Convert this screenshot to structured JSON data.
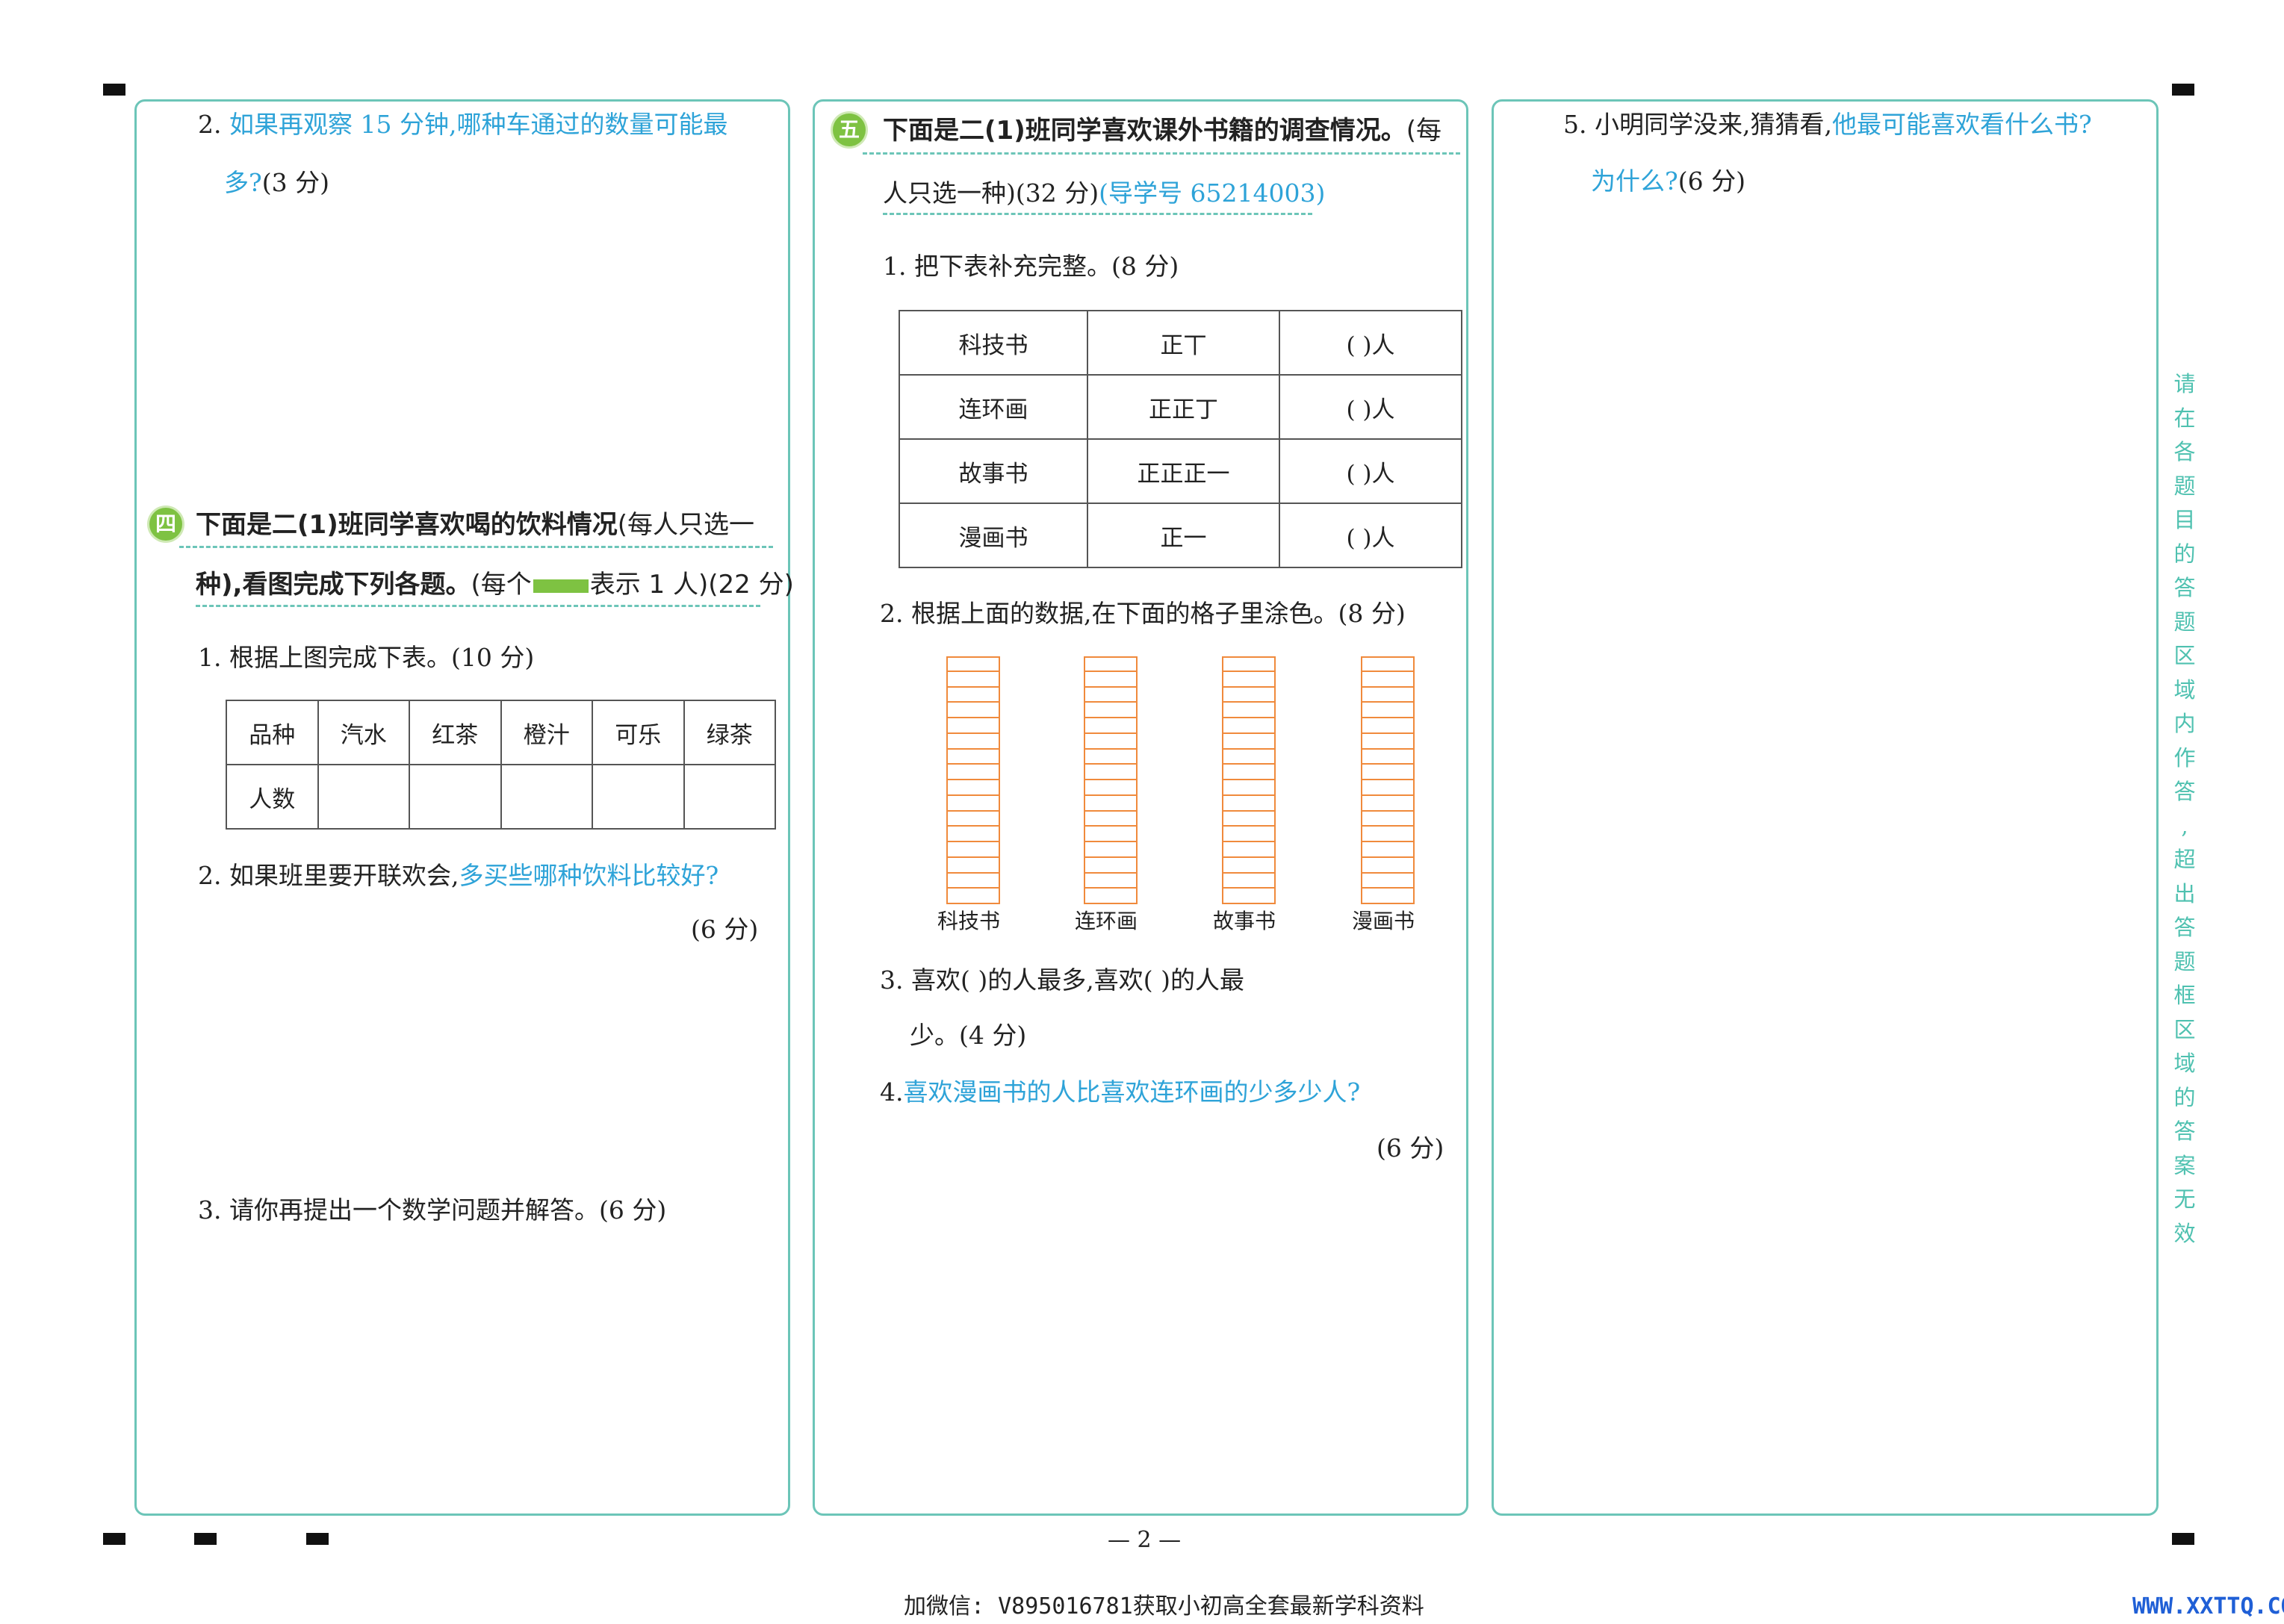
{
  "panel1": {
    "q2_num": "2.",
    "q2_text": "如果再观察 15 分钟,哪种车通过的数量可能最",
    "q2_line2": "多?",
    "q2_score": "(3 分)"
  },
  "section4": {
    "badge": "四",
    "head_line1": "下面是二(1)班同学喜欢喝的饮料情况",
    "head_line1_note": "(每人只选一",
    "head_line2a": "种),看图完成下列各题。",
    "head_line2b": "(每个",
    "head_line2c": "表示 1 人)(22 分)",
    "q1": "1. 根据上图完成下表。(10 分)",
    "table": {
      "header": [
        "品种",
        "汽水",
        "红茶",
        "橙汁",
        "可乐",
        "绿茶"
      ],
      "row2_label": "人数"
    },
    "q2_prefix": "2. 如果班里要开联欢会,",
    "q2_blue": "多买些哪种饮料比较好?",
    "q2_score": "(6 分)",
    "q3": "3. 请你再提出一个数学问题并解答。(6 分)"
  },
  "section5": {
    "badge": "五",
    "head_line1": "下面是二(1)班同学喜欢课外书籍的调查情况。",
    "head_line1_tail": "(每",
    "head_line2": "人只选一种)(32 分)",
    "head_guide": "(导学号  65214003)",
    "q1": "1. 把下表补充完整。(8 分)",
    "rows": [
      {
        "name": "科技书",
        "tally": "正丅",
        "blank": "(      )人"
      },
      {
        "name": "连环画",
        "tally": "正正丁",
        "blank": "(      )人"
      },
      {
        "name": "故事书",
        "tally": "正正正一",
        "blank": "(      )人"
      },
      {
        "name": "漫画书",
        "tally": "正一",
        "blank": "(      )人"
      }
    ],
    "q2": "2. 根据上面的数据,在下面的格子里涂色。(8 分)",
    "grid_labels": [
      "科技书",
      "连环画",
      "故事书",
      "漫画书"
    ],
    "q3_line1": "3. 喜欢(          )的人最多,喜欢(          )的人最",
    "q3_line2": "少。(4 分)",
    "q4_num": "4.",
    "q4_text": "喜欢漫画书的人比喜欢连环画的少多少人?",
    "q4_score": "(6 分)"
  },
  "panel3": {
    "q5_prefix": "5. 小明同学没来,猜猜看,",
    "q5_blue": "他最可能喜欢看什么书?",
    "q5_line2_blue": "为什么?",
    "q5_score": "(6 分)"
  },
  "side_note": "请在各题目的答题区域内作答,超出答题框区域的答案无效",
  "page_number": "— 2 —",
  "footer_text": "加微信: V895016781获取小初高全套最新学科资料",
  "footer_url": "WWW.XXTTQ.COM",
  "colors": {
    "accent": "#6cc5b8",
    "blue_text": "#2ea3d8",
    "badge": "#7ec242",
    "grid": "#f08a3c"
  }
}
